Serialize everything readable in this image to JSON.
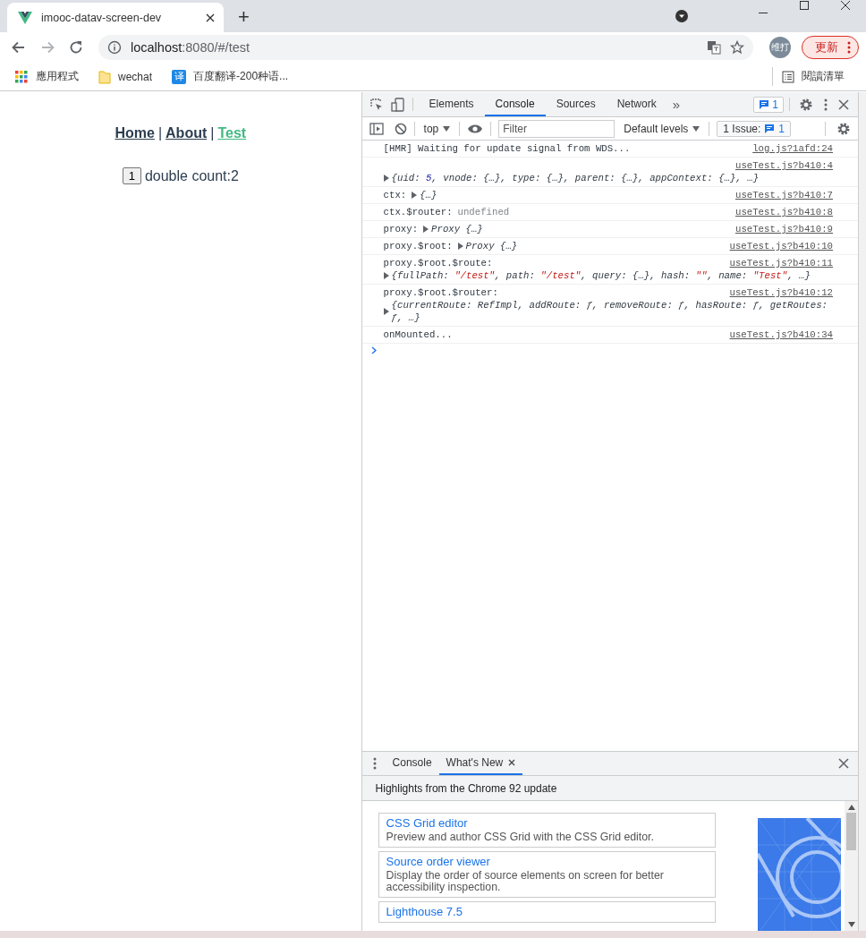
{
  "browser": {
    "tab": {
      "title": "imooc-datav-screen-dev"
    },
    "new_tab": "+",
    "nav_buttons": [
      {
        "kind": "back",
        "disabled": false
      },
      {
        "kind": "forward",
        "disabled": true
      },
      {
        "kind": "reload",
        "disabled": false
      }
    ],
    "address": {
      "host": "localhost",
      "path": ":8080/#/test"
    },
    "profile": "维打",
    "update": "更新",
    "bookmarks": [
      {
        "kind": "apps",
        "label": "應用程式"
      },
      {
        "kind": "folder",
        "label": "wechat"
      },
      {
        "kind": "site",
        "glyph": "译",
        "label": "百度翻译-200种语..."
      }
    ],
    "reading_list": "閱讀清單"
  },
  "page": {
    "nav": [
      {
        "label": "Home",
        "selected": false
      },
      {
        "label": "About",
        "selected": false
      },
      {
        "label": "Test",
        "selected": true
      }
    ],
    "separators": [
      "|",
      "|"
    ],
    "counter": {
      "button": "1",
      "text": "double count:2"
    }
  },
  "devtools": {
    "tabs": [
      {
        "label": "Elements",
        "selected": false
      },
      {
        "label": "Console",
        "selected": true
      },
      {
        "label": "Sources",
        "selected": false
      },
      {
        "label": "Network",
        "selected": false
      }
    ],
    "more": "»",
    "issues_badge": "1",
    "toolbar": {
      "context": "top",
      "filter_placeholder": "Filter",
      "levels": "Default levels",
      "issues_label": "1 Issue:",
      "issues_count": "1"
    },
    "messages": [
      {
        "kind": "text",
        "text": "[HMR] Waiting for update signal from WDS...",
        "source": "log.js?1afd:24"
      },
      {
        "kind": "block",
        "source": "useTest.js?b410:4",
        "expandable": true,
        "tokens": [
          {
            "text": "{uid: ",
            "kind": "plain"
          },
          {
            "text": "5",
            "kind": "number"
          },
          {
            "text": ", vnode: {…}, type: {…}, parent: {…}, appContext: {…}, …}",
            "kind": "plain"
          }
        ]
      },
      {
        "kind": "inline",
        "label": "ctx:",
        "source": "useTest.js?b410:7",
        "expandable": true,
        "tokens": [
          {
            "text": "{…}",
            "kind": "plain"
          }
        ]
      },
      {
        "kind": "inline",
        "label": "ctx.$router:",
        "source": "useTest.js?b410:8",
        "expandable": false,
        "tokens": [
          {
            "text": "undefined",
            "kind": "undefined"
          }
        ]
      },
      {
        "kind": "inline",
        "label": "proxy:",
        "source": "useTest.js?b410:9",
        "expandable": true,
        "tokens": [
          {
            "text": "Proxy {…}",
            "kind": "plain"
          }
        ]
      },
      {
        "kind": "inline",
        "label": "proxy.$root:",
        "source": "useTest.js?b410:10",
        "expandable": true,
        "tokens": [
          {
            "text": "Proxy {…}",
            "kind": "plain"
          }
        ]
      },
      {
        "kind": "block",
        "label": "proxy.$root.$route:",
        "source": "useTest.js?b410:11",
        "expandable": true,
        "tokens": [
          {
            "text": "{fullPath: ",
            "kind": "plain"
          },
          {
            "text": "\"/test\"",
            "kind": "string"
          },
          {
            "text": ", path: ",
            "kind": "plain"
          },
          {
            "text": "\"/test\"",
            "kind": "string"
          },
          {
            "text": ", query: {…}, hash: ",
            "kind": "plain"
          },
          {
            "text": "\"\"",
            "kind": "string"
          },
          {
            "text": ", name: ",
            "kind": "plain"
          },
          {
            "text": "\"Test\"",
            "kind": "string"
          },
          {
            "text": ", …}",
            "kind": "plain"
          }
        ]
      },
      {
        "kind": "block",
        "label": "proxy.$root.$router:",
        "source": "useTest.js?b410:12",
        "expandable": true,
        "tokens": [
          {
            "text": "{currentRoute: RefImpl, addRoute: ƒ, removeRoute: ƒ, hasRoute: ƒ, getRoutes: ƒ, …}",
            "kind": "plain"
          }
        ]
      },
      {
        "kind": "text",
        "text": "onMounted...",
        "source": "useTest.js?b410:34"
      }
    ],
    "drawer": {
      "tabs": [
        {
          "label": "Console",
          "selected": false,
          "closable": false
        },
        {
          "label": "What's New",
          "selected": true,
          "closable": true
        }
      ],
      "header": "Highlights from the Chrome 92 update",
      "cards": [
        {
          "title": "CSS Grid editor",
          "description": "Preview and author CSS Grid with the CSS Grid editor."
        },
        {
          "title": "Source order viewer",
          "description": "Display the order of source elements on screen for better accessibility inspection."
        },
        {
          "title": "Lighthouse 7.5"
        }
      ]
    }
  }
}
